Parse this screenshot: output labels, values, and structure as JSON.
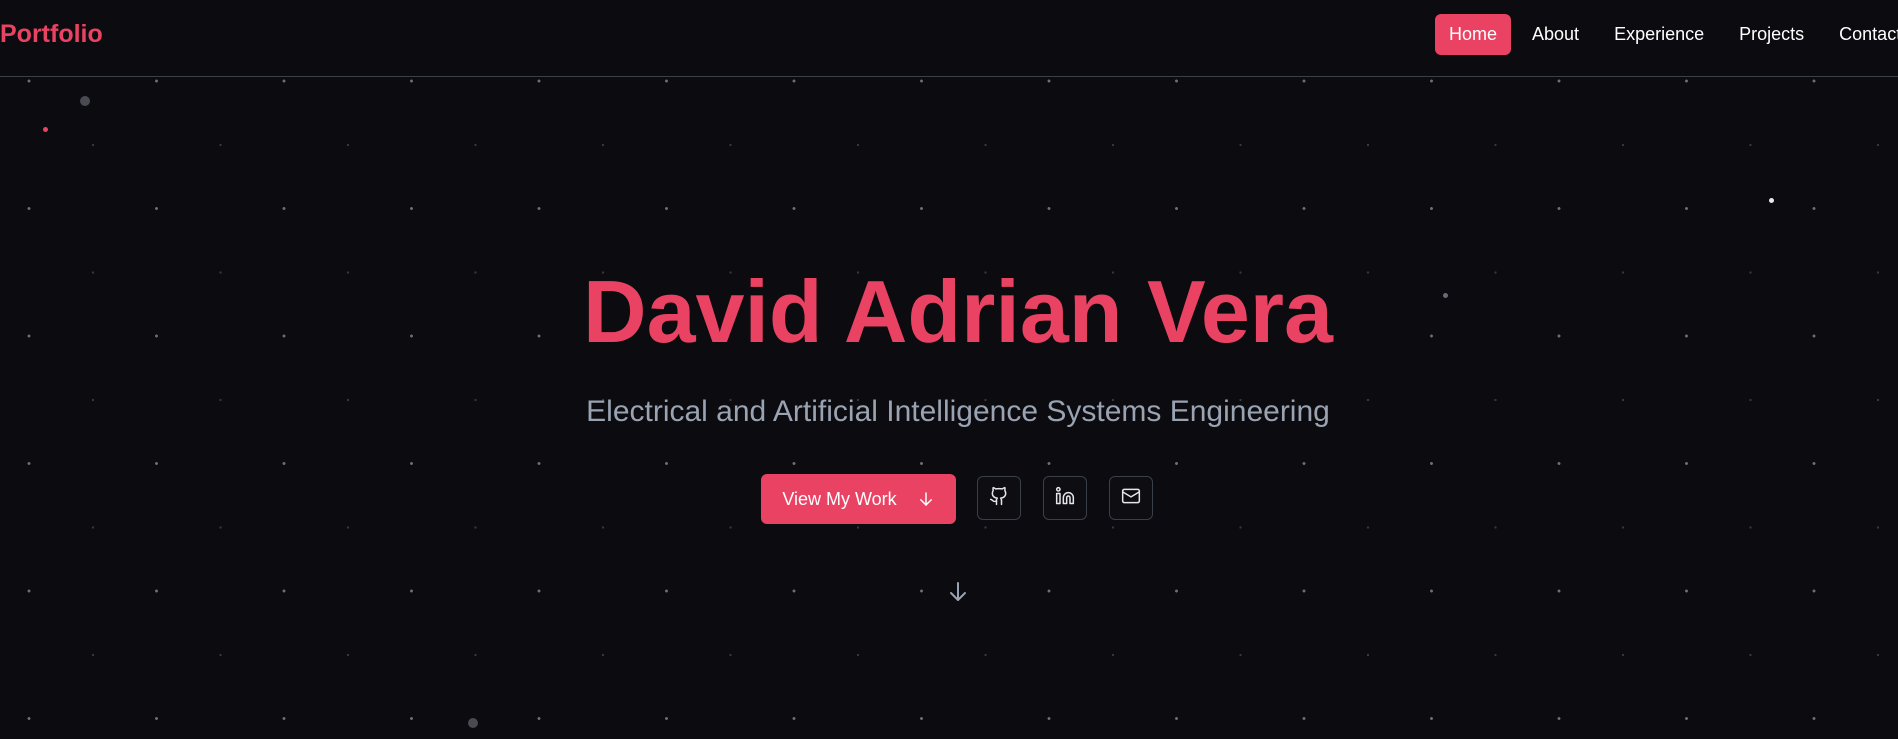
{
  "header": {
    "brand": "Portfolio",
    "nav": [
      {
        "label": "Home",
        "active": true
      },
      {
        "label": "About",
        "active": false
      },
      {
        "label": "Experience",
        "active": false
      },
      {
        "label": "Projects",
        "active": false
      },
      {
        "label": "Contact",
        "active": false
      }
    ]
  },
  "hero": {
    "name": "David Adrian Vera",
    "subtitle": "Electrical and Artificial Intelligence Systems Engineering",
    "cta_label": "View My Work",
    "cta_icon": "arrow-down-icon",
    "socials": [
      {
        "icon": "github-icon"
      },
      {
        "icon": "linkedin-icon"
      },
      {
        "icon": "mail-icon"
      }
    ],
    "scroll_icon": "arrow-down-icon"
  },
  "colors": {
    "accent": "#e94263",
    "background": "#0b0b10",
    "subtitle": "#9aa3b2",
    "border": "#3a3f4e"
  }
}
